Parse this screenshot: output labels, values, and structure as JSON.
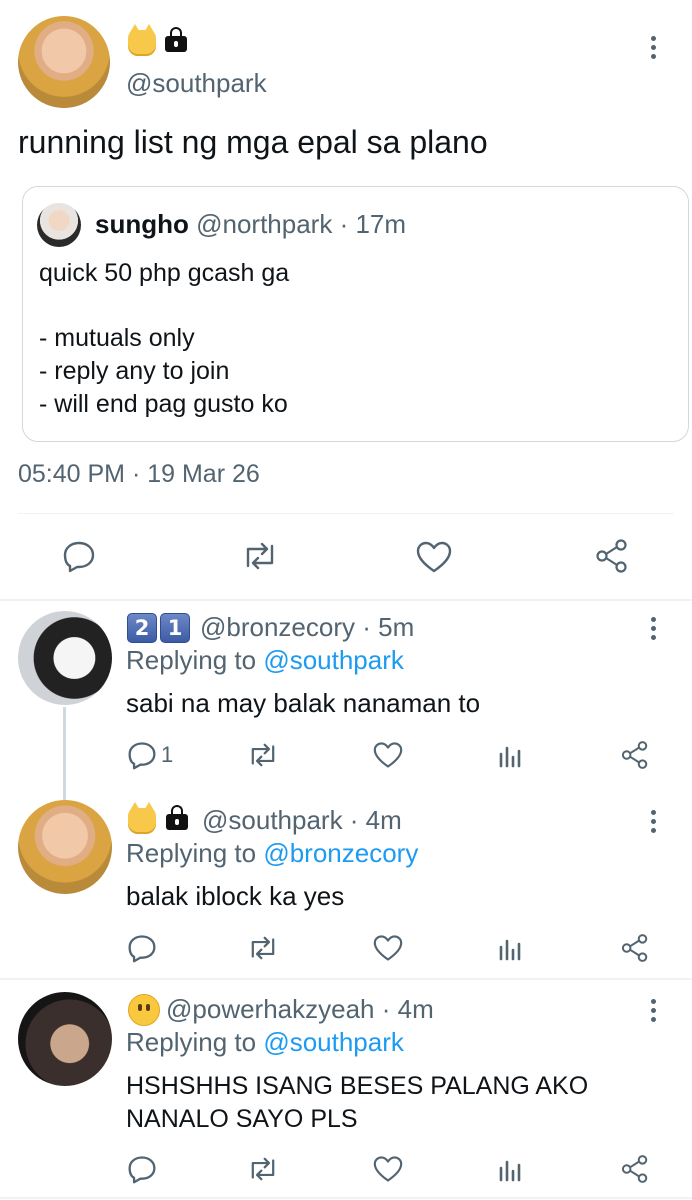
{
  "main_tweet": {
    "handle": "@southpark",
    "text": "running list ng mga epal sa plano",
    "timestamp": "05:40 PM · 19 Mar 26",
    "quoted": {
      "name": "sungho",
      "handle": "@northpark · 17m",
      "lines": [
        "quick 50 php gcash ga",
        "",
        "- mutuals only",
        "- reply any to join",
        "- will end pag gusto ko"
      ]
    }
  },
  "replies": [
    {
      "badge_digits": [
        "2",
        "1"
      ],
      "handle": "@bronzecory · 5m",
      "replying_prefix": "Replying to",
      "replying_to": "@southpark",
      "text": "sabi na may balak nanaman to",
      "reply_count": "1"
    },
    {
      "handle": "@southpark · 4m",
      "replying_prefix": "Replying to",
      "replying_to": "@bronzecory",
      "text": "balak iblock ka yes"
    },
    {
      "handle": "@powerhakzyeah · 4m",
      "replying_prefix": "Replying to",
      "replying_to": "@southpark",
      "text_line1": "HSHSHHS ISANG BESES PALANG AKO",
      "text_line2": "NANALO SAYO PLS"
    }
  ],
  "colors": {
    "text": "#0f1419",
    "secondary": "#536471",
    "link": "#1d9bf0",
    "border": "#cfd9de"
  }
}
